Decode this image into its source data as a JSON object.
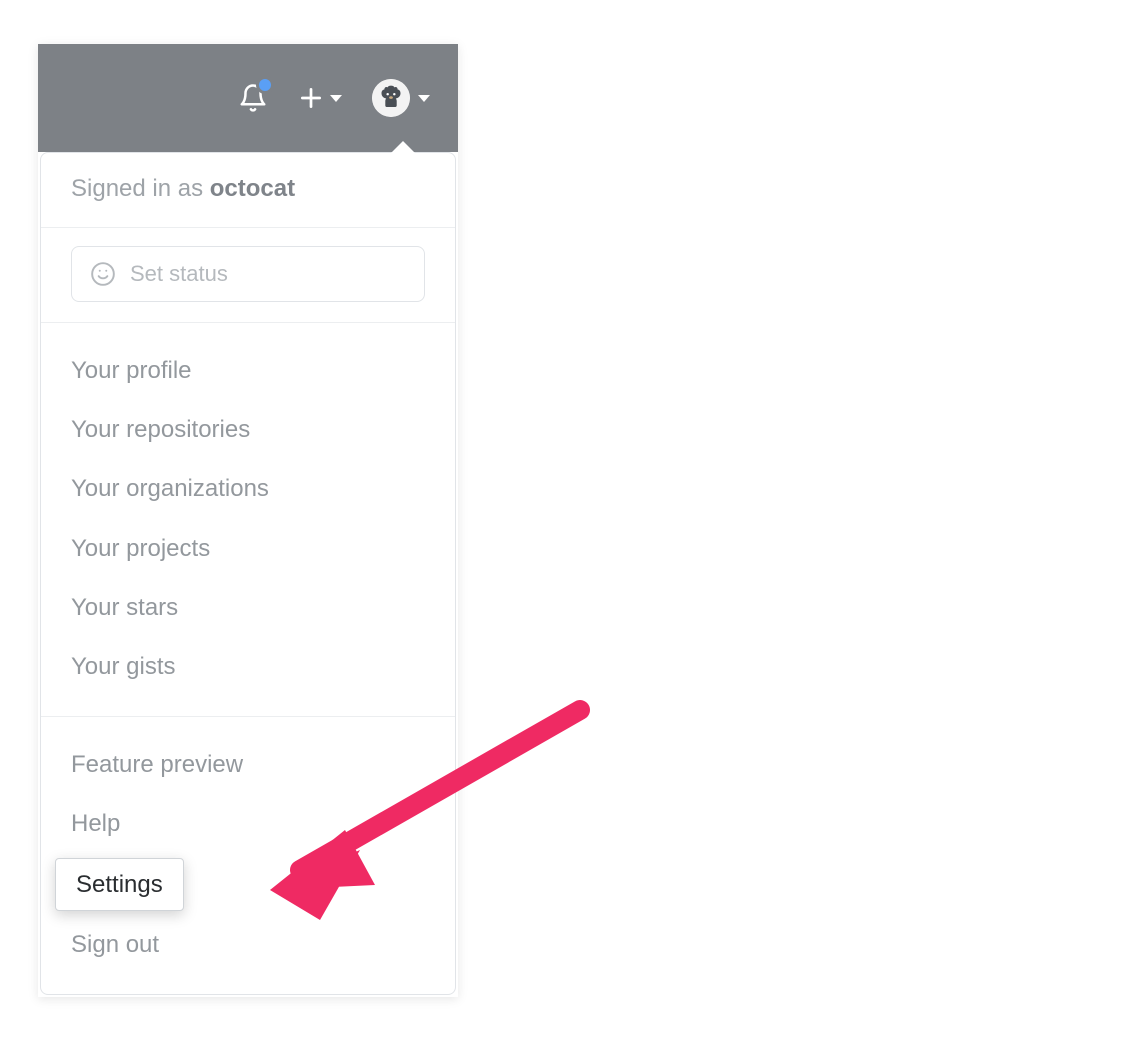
{
  "header": {
    "signed_in_prefix": "Signed in as ",
    "username": "octocat"
  },
  "status": {
    "placeholder": "Set status"
  },
  "menu": {
    "group1": [
      "Your profile",
      "Your repositories",
      "Your organizations",
      "Your projects",
      "Your stars",
      "Your gists"
    ],
    "group2": [
      "Feature preview",
      "Help",
      "Settings",
      "Sign out"
    ],
    "highlighted_index": 2
  }
}
